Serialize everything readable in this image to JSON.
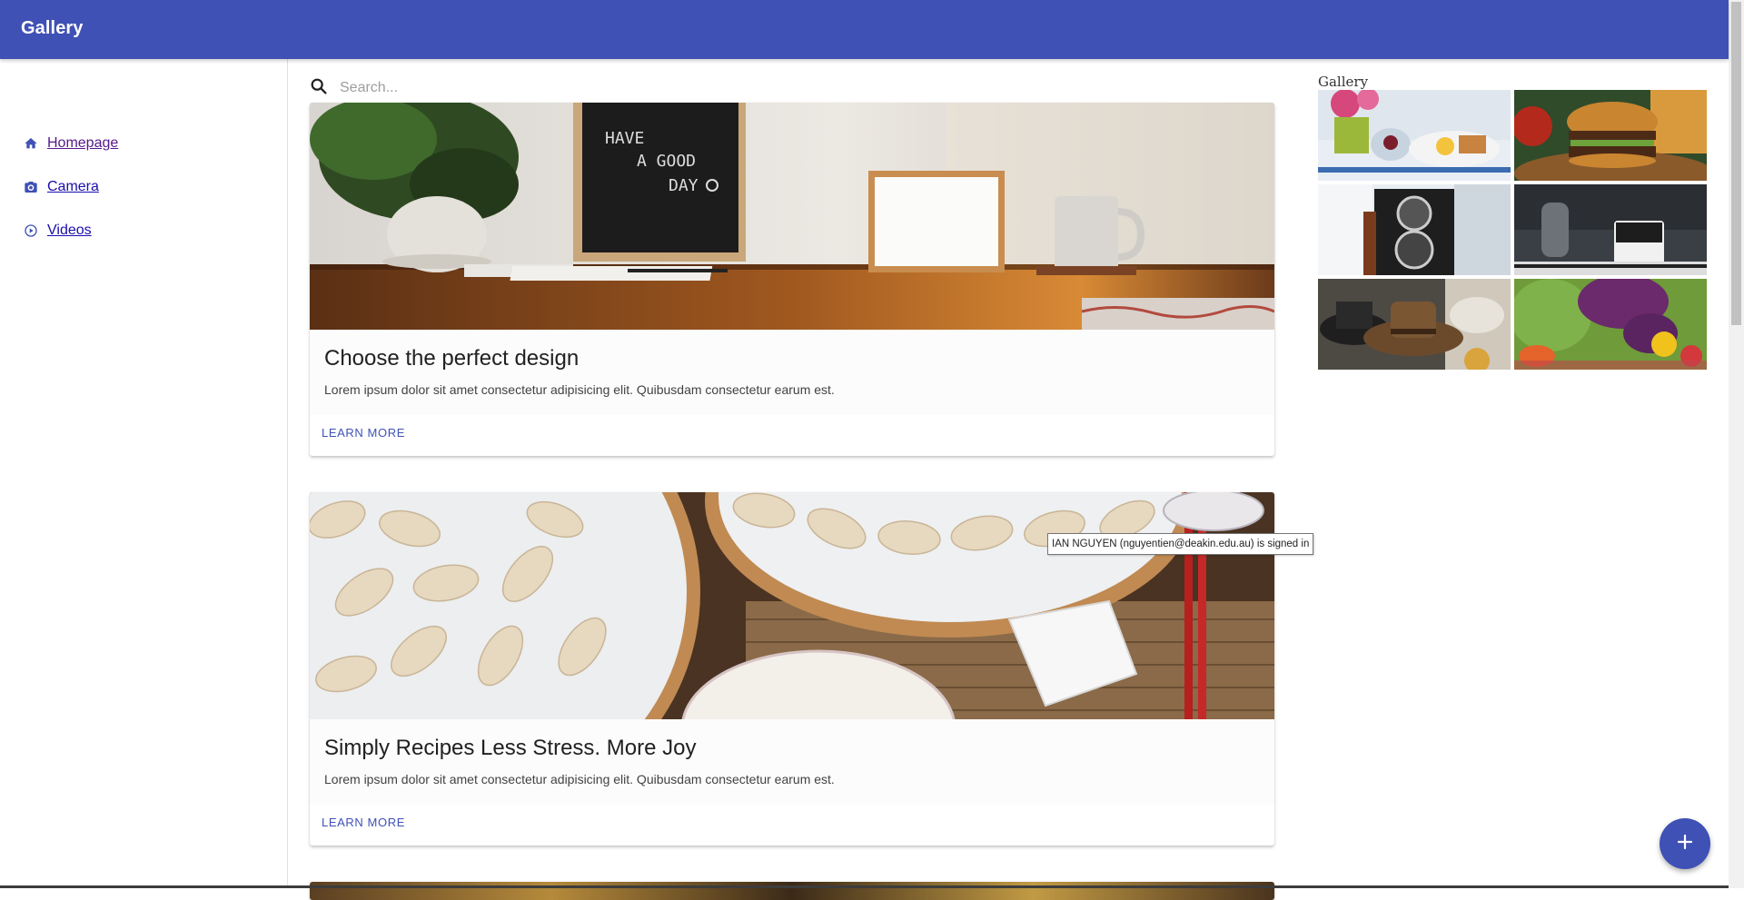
{
  "appbar": {
    "title": "Gallery"
  },
  "sidebar": {
    "items": [
      {
        "label": "Homepage",
        "icon": "home-icon"
      },
      {
        "label": "Camera",
        "icon": "camera-icon"
      },
      {
        "label": "Videos",
        "icon": "play-circle-icon"
      }
    ]
  },
  "search": {
    "placeholder": "Search...",
    "value": ""
  },
  "cards": [
    {
      "title": "Choose the perfect design",
      "text": "Lorem ipsum dolor sit amet consectetur adipisicing elit. Quibusdam consectetur earum est.",
      "action": "LEARN MORE",
      "image": "desk-with-letter-board-and-mug-photo"
    },
    {
      "title": "Simply Recipes Less Stress. More Joy",
      "text": "Lorem ipsum dolor sit amet consectetur adipisicing elit. Quibusdam consectetur earum est.",
      "action": "LEARN MORE",
      "image": "dumplings-in-bamboo-steamer-photo"
    }
  ],
  "gallery": {
    "title": "Gallery",
    "images": [
      "breakfast-table-photo",
      "burger-photo",
      "vintage-camera-photo",
      "coffee-mug-photo",
      "hats-photo",
      "vegetables-photo"
    ]
  },
  "tooltip": {
    "text": "IAN NGUYEN (nguyentien@deakin.edu.au) is signed in"
  },
  "fab": {
    "icon": "plus-icon"
  },
  "colors": {
    "primary": "#3f51b5",
    "link": "#1a0dab",
    "visited_link": "#551a8b"
  }
}
